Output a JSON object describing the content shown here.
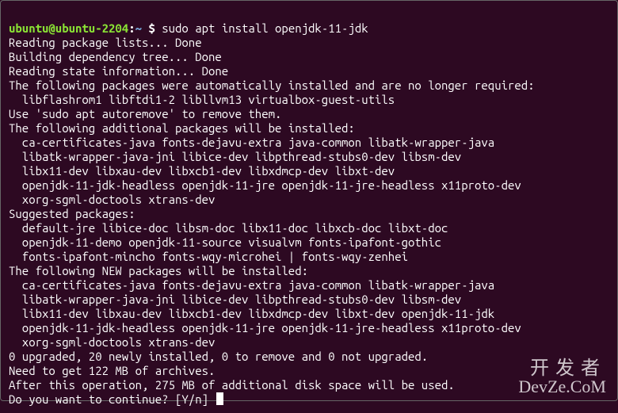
{
  "prompt": {
    "user": "ubuntu@ubuntu-2204",
    "sep": ":",
    "path": "~",
    "dollar": "$"
  },
  "command": "sudo apt install openjdk-11-jdk",
  "output": [
    "Reading package lists... Done",
    "Building dependency tree... Done",
    "Reading state information... Done",
    "The following packages were automatically installed and are no longer required:",
    "  libflashrom1 libftdi1-2 libllvm13 virtualbox-guest-utils",
    "Use 'sudo apt autoremove' to remove them.",
    "The following additional packages will be installed:",
    "  ca-certificates-java fonts-dejavu-extra java-common libatk-wrapper-java",
    "  libatk-wrapper-java-jni libice-dev libpthread-stubs0-dev libsm-dev",
    "  libx11-dev libxau-dev libxcb1-dev libxdmcp-dev libxt-dev",
    "  openjdk-11-jdk-headless openjdk-11-jre openjdk-11-jre-headless x11proto-dev",
    "  xorg-sgml-doctools xtrans-dev",
    "Suggested packages:",
    "  default-jre libice-doc libsm-doc libx11-doc libxcb-doc libxt-doc",
    "  openjdk-11-demo openjdk-11-source visualvm fonts-ipafont-gothic",
    "  fonts-ipafont-mincho fonts-wqy-microhei | fonts-wqy-zenhei",
    "The following NEW packages will be installed:",
    "  ca-certificates-java fonts-dejavu-extra java-common libatk-wrapper-java",
    "  libatk-wrapper-java-jni libice-dev libpthread-stubs0-dev libsm-dev",
    "  libx11-dev libxau-dev libxcb1-dev libxdmcp-dev libxt-dev openjdk-11-jdk",
    "  openjdk-11-jdk-headless openjdk-11-jre openjdk-11-jre-headless x11proto-dev",
    "  xorg-sgml-doctools xtrans-dev",
    "0 upgraded, 20 newly installed, 0 to remove and 0 not upgraded.",
    "Need to get 122 MB of archives.",
    "After this operation, 275 MB of additional disk space will be used.",
    "Do you want to continue? [Y/n] "
  ],
  "watermark": {
    "cn": "开发者",
    "en": "DevZe.CoM"
  }
}
